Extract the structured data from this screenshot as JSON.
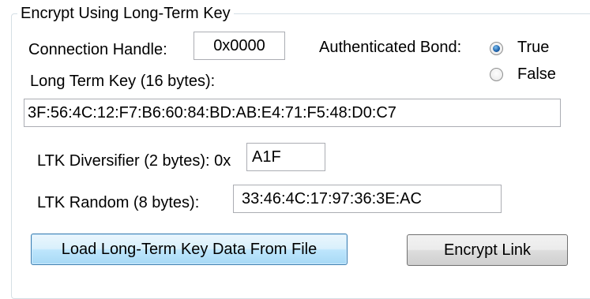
{
  "group": {
    "title": "Encrypt Using Long-Term Key"
  },
  "connection_handle": {
    "label": "Connection Handle:",
    "value": "0x0000"
  },
  "authenticated_bond": {
    "label": "Authenticated Bond:",
    "options": [
      {
        "label": "True",
        "selected": true
      },
      {
        "label": "False",
        "selected": false
      }
    ]
  },
  "ltk": {
    "label": "Long Term Key (16 bytes):",
    "value": "3F:56:4C:12:F7:B6:60:84:BD:AB:E4:71:F5:48:D0:C7"
  },
  "ltk_diversifier": {
    "label": "LTK Diversifier (2 bytes): 0x",
    "value": "A1F"
  },
  "ltk_random": {
    "label": "LTK Random (8 bytes):",
    "value": "33:46:4C:17:97:36:3E:AC"
  },
  "buttons": {
    "load_label": "Load Long-Term Key Data From File",
    "encrypt_label": "Encrypt Link"
  }
}
